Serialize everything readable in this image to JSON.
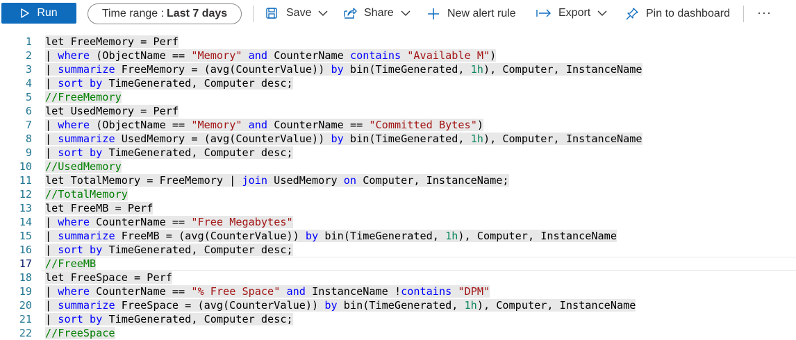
{
  "toolbar": {
    "run_label": "Run",
    "time_range_label": "Time range :",
    "time_range_value": "Last 7 days",
    "save_label": "Save",
    "share_label": "Share",
    "new_alert_label": "New alert rule",
    "export_label": "Export",
    "pin_label": "Pin to dashboard",
    "more_label": "···"
  },
  "colors": {
    "run_button": "#0f6cbd",
    "keyword": "#0000ff",
    "string": "#a31515",
    "comment": "#008000",
    "number": "#098658",
    "line_number": "#237893",
    "selection": "#e8e8e8"
  },
  "editor": {
    "active_line": 17,
    "lines": [
      {
        "n": "1",
        "tokens": [
          [
            "p",
            "let FreeMemory = Perf"
          ]
        ]
      },
      {
        "n": "2",
        "tokens": [
          [
            "p",
            "| "
          ],
          [
            "k",
            "where"
          ],
          [
            "p",
            " (ObjectName == "
          ],
          [
            "s",
            "\"Memory\""
          ],
          [
            "p",
            " "
          ],
          [
            "k",
            "and"
          ],
          [
            "p",
            " CounterName "
          ],
          [
            "k",
            "contains"
          ],
          [
            "p",
            " "
          ],
          [
            "s",
            "\"Available M\""
          ],
          [
            "p",
            ")"
          ]
        ]
      },
      {
        "n": "3",
        "tokens": [
          [
            "p",
            "| "
          ],
          [
            "k",
            "summarize"
          ],
          [
            "p",
            " FreeMemory = (avg(CounterValue)) "
          ],
          [
            "k",
            "by"
          ],
          [
            "p",
            " bin(TimeGenerated, "
          ],
          [
            "n",
            "1h"
          ],
          [
            "p",
            "), Computer, InstanceName"
          ]
        ]
      },
      {
        "n": "4",
        "tokens": [
          [
            "p",
            "| "
          ],
          [
            "k",
            "sort by"
          ],
          [
            "p",
            " TimeGenerated, Computer desc;"
          ]
        ]
      },
      {
        "n": "5",
        "tokens": [
          [
            "c",
            "//FreeMemory"
          ]
        ]
      },
      {
        "n": "6",
        "tokens": [
          [
            "p",
            "let UsedMemory = Perf"
          ]
        ]
      },
      {
        "n": "7",
        "tokens": [
          [
            "p",
            "| "
          ],
          [
            "k",
            "where"
          ],
          [
            "p",
            " (ObjectName == "
          ],
          [
            "s",
            "\"Memory\""
          ],
          [
            "p",
            " "
          ],
          [
            "k",
            "and"
          ],
          [
            "p",
            " CounterName == "
          ],
          [
            "s",
            "\"Committed Bytes\""
          ],
          [
            "p",
            ")"
          ]
        ]
      },
      {
        "n": "8",
        "tokens": [
          [
            "p",
            "| "
          ],
          [
            "k",
            "summarize"
          ],
          [
            "p",
            " UsedMemory = (avg(CounterValue)) "
          ],
          [
            "k",
            "by"
          ],
          [
            "p",
            " bin(TimeGenerated, "
          ],
          [
            "n",
            "1h"
          ],
          [
            "p",
            "), Computer, InstanceName"
          ]
        ]
      },
      {
        "n": "9",
        "tokens": [
          [
            "p",
            "| "
          ],
          [
            "k",
            "sort by"
          ],
          [
            "p",
            " TimeGenerated, Computer desc;"
          ]
        ]
      },
      {
        "n": "10",
        "tokens": [
          [
            "c",
            "//UsedMemory"
          ]
        ]
      },
      {
        "n": "11",
        "tokens": [
          [
            "p",
            "let TotalMemory = FreeMemory | "
          ],
          [
            "k",
            "join"
          ],
          [
            "p",
            " UsedMemory "
          ],
          [
            "k",
            "on"
          ],
          [
            "p",
            " Computer, InstanceName;"
          ]
        ]
      },
      {
        "n": "12",
        "tokens": [
          [
            "c",
            "//TotalMemory"
          ]
        ]
      },
      {
        "n": "13",
        "tokens": [
          [
            "p",
            "let FreeMB = Perf"
          ]
        ]
      },
      {
        "n": "14",
        "tokens": [
          [
            "p",
            "| "
          ],
          [
            "k",
            "where"
          ],
          [
            "p",
            " CounterName == "
          ],
          [
            "s",
            "\"Free Megabytes\""
          ]
        ]
      },
      {
        "n": "15",
        "tokens": [
          [
            "p",
            "| "
          ],
          [
            "k",
            "summarize"
          ],
          [
            "p",
            " FreeMB = (avg(CounterValue)) "
          ],
          [
            "k",
            "by"
          ],
          [
            "p",
            " bin(TimeGenerated, "
          ],
          [
            "n",
            "1h"
          ],
          [
            "p",
            "), Computer, InstanceName"
          ]
        ]
      },
      {
        "n": "16",
        "tokens": [
          [
            "p",
            "| "
          ],
          [
            "k",
            "sort by"
          ],
          [
            "p",
            " TimeGenerated, Computer desc;"
          ]
        ]
      },
      {
        "n": "17",
        "tokens": [
          [
            "c",
            "//FreeMB"
          ]
        ]
      },
      {
        "n": "18",
        "tokens": [
          [
            "p",
            "let FreeSpace = Perf"
          ]
        ]
      },
      {
        "n": "19",
        "tokens": [
          [
            "p",
            "| "
          ],
          [
            "k",
            "where"
          ],
          [
            "p",
            " CounterName == "
          ],
          [
            "s",
            "\"% Free Space\""
          ],
          [
            "p",
            " "
          ],
          [
            "k",
            "and"
          ],
          [
            "p",
            " InstanceName !"
          ],
          [
            "k",
            "contains"
          ],
          [
            "p",
            " "
          ],
          [
            "s",
            "\"DPM\""
          ]
        ]
      },
      {
        "n": "20",
        "tokens": [
          [
            "p",
            "| "
          ],
          [
            "k",
            "summarize"
          ],
          [
            "p",
            " FreeSpace = (avg(CounterValue)) "
          ],
          [
            "k",
            "by"
          ],
          [
            "p",
            " bin(TimeGenerated, "
          ],
          [
            "n",
            "1h"
          ],
          [
            "p",
            "), Computer, InstanceName"
          ]
        ]
      },
      {
        "n": "21",
        "tokens": [
          [
            "p",
            "| "
          ],
          [
            "k",
            "sort by"
          ],
          [
            "p",
            " TimeGenerated, Computer desc;"
          ]
        ]
      },
      {
        "n": "22",
        "tokens": [
          [
            "c",
            "//FreeSpace"
          ]
        ]
      }
    ]
  }
}
